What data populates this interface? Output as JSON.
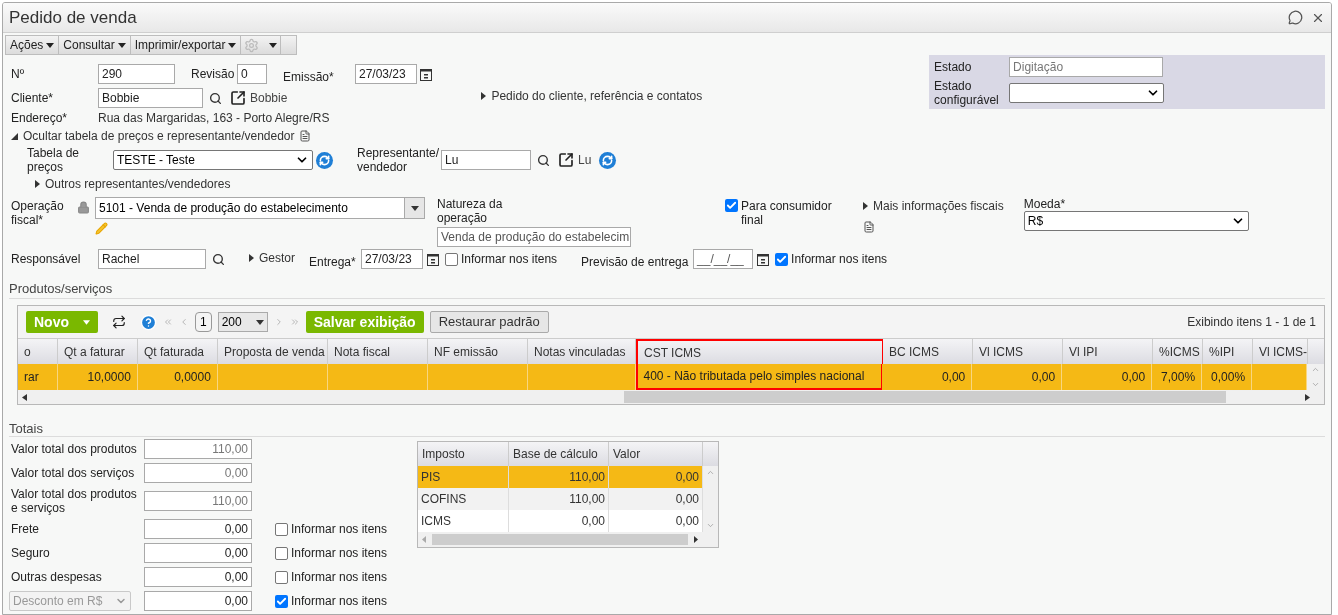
{
  "window": {
    "title": "Pedido de venda"
  },
  "toolbar": [
    {
      "label": "Ações"
    },
    {
      "label": "Consultar"
    },
    {
      "label": "Imprimir/exportar"
    }
  ],
  "numero": {
    "label": "Nº",
    "value": "290"
  },
  "revisao": {
    "label": "Revisão",
    "value": "0"
  },
  "emissao": {
    "label": "Emissão*",
    "value": "27/03/23"
  },
  "cliente": {
    "label": "Cliente*",
    "value": "Bobbie",
    "link": "Bobbie"
  },
  "pedido_cliente": {
    "label": "Pedido do cliente, referência e contatos",
    "expanded": false
  },
  "estado": {
    "label": "Estado",
    "value": "Digitação"
  },
  "estado_configuravel": {
    "label": "Estado configurável"
  },
  "endereco": {
    "label": "Endereço*",
    "value": "Rua das Margaridas, 163 - Porto Alegre/RS"
  },
  "ocultar": {
    "label": "Ocultar tabela de preços e representante/vendedor",
    "expanded": true
  },
  "tabela_precos": {
    "label": "Tabela de preços",
    "value": "TESTE - Teste"
  },
  "representante": {
    "label": "Representante/ vendedor",
    "value": "Lu",
    "link": "Lu"
  },
  "outros": {
    "label": "Outros representantes/vendedores",
    "expanded": false
  },
  "operacao_fiscal": {
    "label": "Operação fiscal*",
    "value": "5101 - Venda de produção do estabelecimento"
  },
  "natureza": {
    "label": "Natureza da operação",
    "value": "Venda de produção do estabelecim"
  },
  "consumidor_final": {
    "label": "Para consumidor final",
    "checked": true
  },
  "mais_info": {
    "label": "Mais informações fiscais",
    "expanded": false
  },
  "moeda": {
    "label": "Moeda*",
    "value": "R$"
  },
  "responsavel": {
    "label": "Responsável",
    "value": "Rachel"
  },
  "gestor": {
    "label": "Gestor",
    "expanded": false
  },
  "entrega": {
    "label": "Entrega*",
    "value": "27/03/23",
    "informar": {
      "label": "Informar nos itens",
      "checked": false
    }
  },
  "previsao": {
    "label": "Previsão de entrega",
    "value": "__/__/__",
    "informar": {
      "label": "Informar nos itens",
      "checked": true
    }
  },
  "produtos": {
    "title": "Produtos/serviços",
    "novo": "Novo",
    "page": "1",
    "page_size": "200",
    "salvar": "Salvar exibição",
    "restaurar": "Restaurar padrão",
    "info": "Exibindo itens 1 - 1 de 1",
    "columns": [
      {
        "label": "o",
        "highlighted": false
      },
      {
        "label": "Qt a faturar",
        "highlighted": false
      },
      {
        "label": "Qt faturada",
        "highlighted": false
      },
      {
        "label": "Proposta de venda",
        "highlighted": false
      },
      {
        "label": "Nota fiscal",
        "highlighted": false
      },
      {
        "label": "NF emissão",
        "highlighted": false
      },
      {
        "label": "Notas vinculadas",
        "highlighted": false
      },
      {
        "label": "CST ICMS",
        "highlighted": true
      },
      {
        "label": "BC ICMS",
        "highlighted": false
      },
      {
        "label": "Vl ICMS",
        "highlighted": false
      },
      {
        "label": "Vl IPI",
        "highlighted": false
      },
      {
        "label": "%ICMS",
        "highlighted": false
      },
      {
        "label": "%IPI",
        "highlighted": false
      },
      {
        "label": "Vl ICMS-",
        "highlighted": false
      }
    ],
    "rows": [
      {
        "selected": true,
        "cells": [
          "rar",
          "10,0000",
          "0,0000",
          "",
          "",
          "",
          "",
          "400 - Não tributada pelo simples nacional",
          "0,00",
          "0,00",
          "0,00",
          "7,00%",
          "0,00%",
          ""
        ]
      }
    ]
  },
  "totais": {
    "title": "Totais",
    "rows": [
      {
        "kind": "readonly",
        "label": "Valor total dos produtos",
        "value": "110,00"
      },
      {
        "kind": "readonly",
        "label": "Valor total dos serviços",
        "value": "0,00"
      },
      {
        "kind": "readonly",
        "label": "Valor total dos produtos e serviços",
        "value": "110,00"
      },
      {
        "kind": "input",
        "label": "Frete",
        "value": "0,00",
        "informar": {
          "label": "Informar nos itens",
          "checked": false
        }
      },
      {
        "kind": "input",
        "label": "Seguro",
        "value": "0,00",
        "informar": {
          "label": "Informar nos itens",
          "checked": false
        }
      },
      {
        "kind": "input",
        "label": "Outras despesas",
        "value": "0,00",
        "informar": {
          "label": "Informar nos itens",
          "checked": false
        }
      },
      {
        "kind": "select",
        "label": "Desconto em R$",
        "value": "0,00",
        "informar": {
          "label": "Informar nos itens",
          "checked": true
        }
      }
    ]
  },
  "impostos": {
    "columns": [
      "Imposto",
      "Base de cálculo",
      "Valor"
    ],
    "rows": [
      {
        "selected": true,
        "cells": [
          "PIS",
          "110,00",
          "0,00"
        ]
      },
      {
        "selected": false,
        "cells": [
          "COFINS",
          "110,00",
          "0,00"
        ]
      },
      {
        "selected": false,
        "cells": [
          "ICMS",
          "0,00",
          "0,00"
        ]
      }
    ]
  }
}
